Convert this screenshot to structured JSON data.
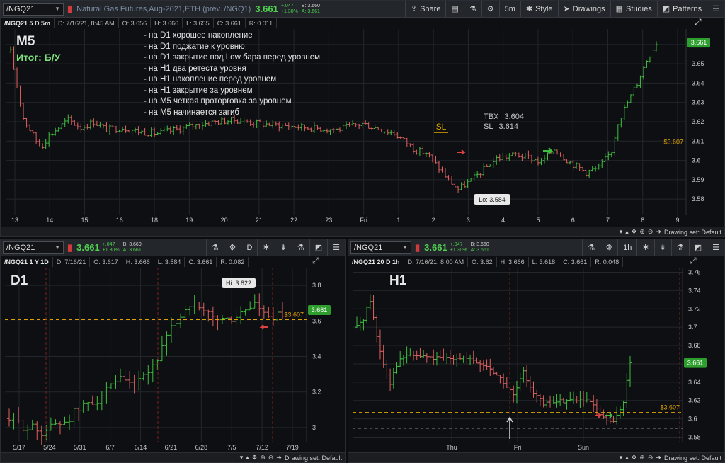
{
  "colors": {
    "up": "#3fbf3f",
    "down": "#e06060",
    "level": "#e0a400",
    "grid": "#23262b",
    "bg": "#0d0f12",
    "last": "#2e9e2e"
  },
  "icons": [
    "share-icon",
    "notes-icon",
    "flask-icon",
    "gear-icon",
    "style-icon",
    "drawings-icon",
    "studies-icon",
    "patterns-icon",
    "menu-icon",
    "pan-icon",
    "zoom-in-icon",
    "zoom-out-icon",
    "arrow-right-icon"
  ],
  "top": {
    "symbol": "/NGQ21",
    "description": "Natural Gas Futures,Aug-2021,ETH (prev. /NGQ1)",
    "last": "3.661",
    "change": "+.047",
    "change_pct": "+1.30%",
    "bid": "B: 3.660",
    "ask": "A: 3.661",
    "buttons": {
      "share": "Share",
      "timeframe": "5m",
      "style": "Style",
      "drawings": "Drawings",
      "studies": "Studies",
      "patterns": "Patterns"
    },
    "info": {
      "symbol": "/NGQ21 5 D 5m",
      "date": "D: 7/16/21, 8:45 AM",
      "open": "O: 3.656",
      "high": "H: 3.666",
      "low": "L: 3.655",
      "close": "C: 3.661",
      "range": "R: 0.011"
    },
    "title": "M5",
    "result": "Итог: Б/У",
    "notes": [
      "- на D1 хорошее накопление",
      "- на D1 поджатие к уровню",
      "- на D1 закрытие под Low бара перед уровнем",
      "- на H1 два ретеста уровня",
      "- на H1 накопление перед уровнем",
      "- на H1 закрытие за уровнем",
      "- на M5 четкая проторговка за уровнем",
      "- на M5 начинается загиб"
    ],
    "tbx": {
      "label1": "TBX",
      "value1": "3.604",
      "label2": "SL",
      "value2": "3.614"
    },
    "drawing_set": "Drawing set: Default"
  },
  "d1": {
    "symbol": "/NGQ21",
    "last": "3.661",
    "change": "+.047",
    "change_pct": "+1.30%",
    "bid": "B: 3.660",
    "ask": "A: 3.661",
    "timeframe": "D",
    "info": {
      "symbol": "/NGQ21 1 Y 1D",
      "date": "D: 7/16/21",
      "open": "O: 3.617",
      "high": "H: 3.666",
      "low": "L: 3.584",
      "close": "C: 3.661",
      "range": "R: 0.082"
    },
    "title": "D1",
    "drawing_set": "Drawing set: Default"
  },
  "h1": {
    "symbol": "/NGQ21",
    "last": "3.661",
    "change": "+.047",
    "change_pct": "+1.30%",
    "bid": "B: 3.660",
    "ask": "A: 3.661",
    "timeframe": "1h",
    "info": {
      "symbol": "/NGQ21 20 D 1h",
      "date": "D: 7/16/21, 8:00 AM",
      "open": "O: 3.62",
      "high": "H: 3.666",
      "low": "L: 3.618",
      "close": "C: 3.661",
      "range": "R: 0.048"
    },
    "title": "H1",
    "drawing_set": "Drawing set: Default"
  },
  "chart_data": [
    {
      "id": "m5",
      "type": "candlestick",
      "x_ticks": [
        "13",
        "14",
        "15",
        "16",
        "18",
        "19",
        "20",
        "21",
        "22",
        "23",
        "Fri",
        "1",
        "2",
        "3",
        "4",
        "5",
        "6",
        "7",
        "8",
        "9"
      ],
      "y_ticks": [
        3.58,
        3.59,
        3.6,
        3.61,
        3.62,
        3.63,
        3.64,
        3.65,
        3.66
      ],
      "ylim": [
        3.572,
        3.668
      ],
      "level": 3.607,
      "level_label": "$3.607",
      "last": 3.661,
      "last_label": "3.661",
      "low_label": "Lo: 3.584",
      "sl_label": "SL",
      "path": [
        [
          0,
          3.656
        ],
        [
          4,
          3.622
        ],
        [
          8,
          3.61
        ],
        [
          10,
          3.608
        ],
        [
          12,
          3.613
        ],
        [
          18,
          3.621
        ],
        [
          22,
          3.617
        ],
        [
          26,
          3.62
        ],
        [
          30,
          3.616
        ],
        [
          35,
          3.617
        ],
        [
          40,
          3.615
        ],
        [
          46,
          3.614
        ],
        [
          52,
          3.616
        ],
        [
          57,
          3.618
        ],
        [
          64,
          3.62
        ],
        [
          70,
          3.621
        ],
        [
          78,
          3.619
        ],
        [
          86,
          3.618
        ],
        [
          93,
          3.617
        ],
        [
          102,
          3.616
        ],
        [
          110,
          3.619
        ],
        [
          116,
          3.616
        ],
        [
          120,
          3.614
        ],
        [
          124,
          3.609
        ],
        [
          127,
          3.605
        ],
        [
          130,
          3.604
        ],
        [
          133,
          3.598
        ],
        [
          137,
          3.59
        ],
        [
          140,
          3.585
        ],
        [
          145,
          3.591
        ],
        [
          152,
          3.601
        ],
        [
          158,
          3.603
        ],
        [
          163,
          3.601
        ],
        [
          166,
          3.599
        ],
        [
          170,
          3.606
        ],
        [
          175,
          3.599
        ],
        [
          180,
          3.594
        ],
        [
          184,
          3.596
        ],
        [
          188,
          3.605
        ],
        [
          190,
          3.62
        ],
        [
          193,
          3.63
        ],
        [
          196,
          3.64
        ],
        [
          199,
          3.652
        ],
        [
          202,
          3.661
        ]
      ]
    },
    {
      "id": "d1",
      "type": "candlestick",
      "x_ticks": [
        "5/17",
        "5/24",
        "5/31",
        "6/7",
        "6/14",
        "6/21",
        "6/28",
        "7/5",
        "7/12",
        "7/19"
      ],
      "y_ticks": [
        3.0,
        3.2,
        3.4,
        3.6,
        3.8
      ],
      "ylim": [
        2.92,
        3.9
      ],
      "level": 3.607,
      "level_label": "$3.607",
      "last": 3.661,
      "last_label": "3.661",
      "high_label": "Hi: 3.822",
      "path": [
        [
          0,
          3.05
        ],
        [
          4,
          3.0
        ],
        [
          7,
          2.98
        ],
        [
          12,
          3.04
        ],
        [
          16,
          3.12
        ],
        [
          20,
          3.18
        ],
        [
          24,
          3.26
        ],
        [
          27,
          3.22
        ],
        [
          30,
          3.3
        ],
        [
          33,
          3.44
        ],
        [
          36,
          3.6
        ],
        [
          39,
          3.7
        ],
        [
          41,
          3.65
        ],
        [
          44,
          3.62
        ],
        [
          47,
          3.6
        ],
        [
          50,
          3.64
        ],
        [
          53,
          3.7
        ],
        [
          55,
          3.63
        ],
        [
          57,
          3.6
        ],
        [
          59,
          3.64
        ]
      ]
    },
    {
      "id": "h1",
      "type": "candlestick",
      "x_ticks": [
        "Thu",
        "Fri",
        "Sun"
      ],
      "y_ticks": [
        3.58,
        3.6,
        3.62,
        3.64,
        3.66,
        3.68,
        3.7,
        3.72,
        3.74,
        3.76
      ],
      "ylim": [
        3.575,
        3.765
      ],
      "level": 3.607,
      "level_label": "$3.607",
      "last": 3.661,
      "last_label": "3.661",
      "path": [
        [
          0,
          3.7
        ],
        [
          2,
          3.71
        ],
        [
          4,
          3.73
        ],
        [
          6,
          3.69
        ],
        [
          8,
          3.66
        ],
        [
          10,
          3.64
        ],
        [
          12,
          3.66
        ],
        [
          15,
          3.67
        ],
        [
          20,
          3.668
        ],
        [
          25,
          3.665
        ],
        [
          30,
          3.668
        ],
        [
          35,
          3.663
        ],
        [
          40,
          3.655
        ],
        [
          44,
          3.64
        ],
        [
          47,
          3.625
        ],
        [
          50,
          3.65
        ],
        [
          53,
          3.63
        ],
        [
          56,
          3.615
        ],
        [
          59,
          3.618
        ],
        [
          62,
          3.62
        ],
        [
          66,
          3.621
        ],
        [
          70,
          3.618
        ],
        [
          74,
          3.6
        ],
        [
          77,
          3.595
        ],
        [
          80,
          3.62
        ],
        [
          82,
          3.661
        ]
      ]
    }
  ]
}
